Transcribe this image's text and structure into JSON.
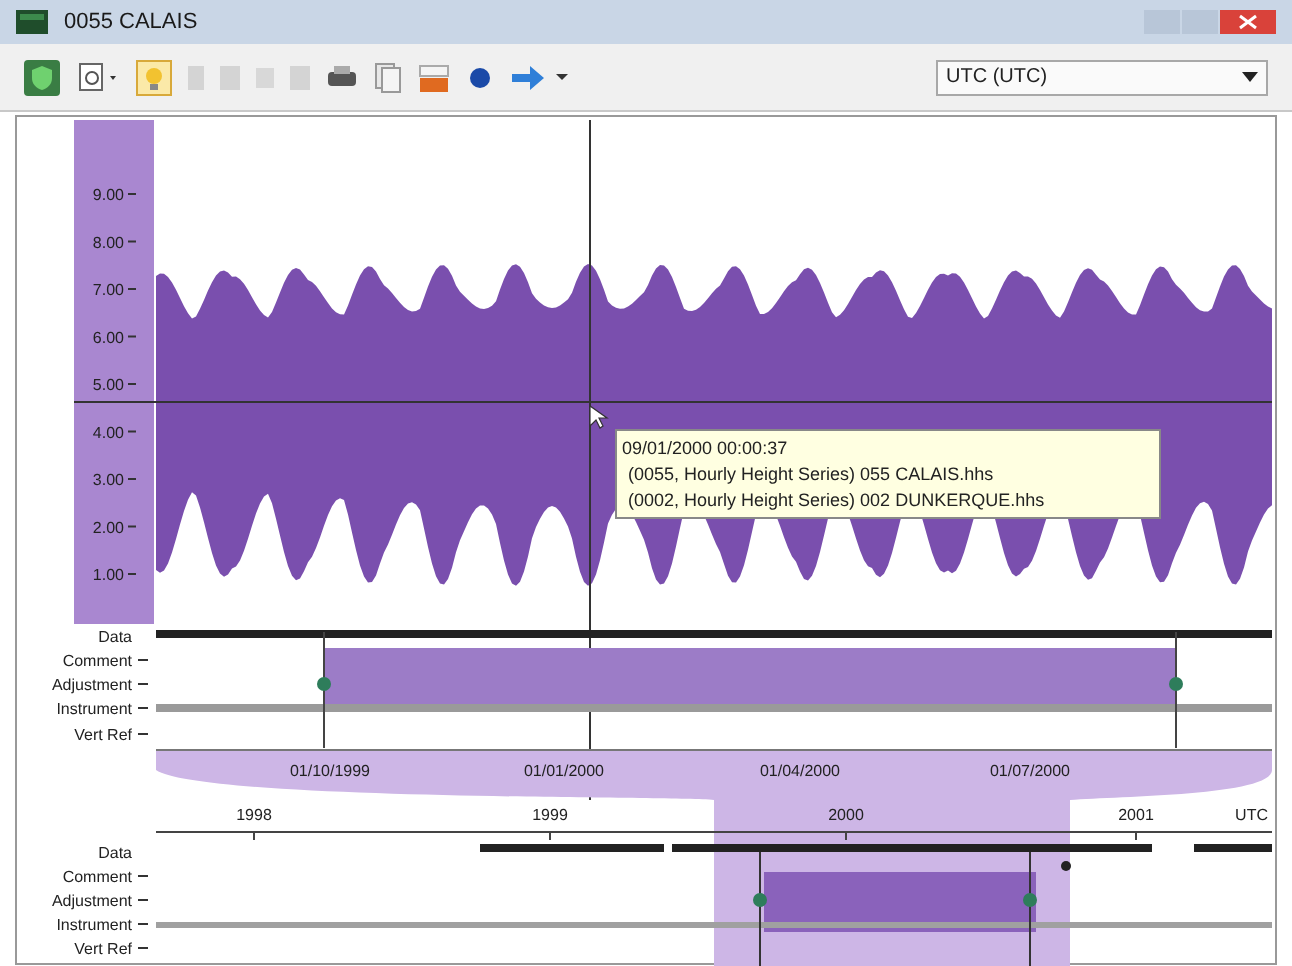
{
  "window": {
    "title": "0055 CALAIS"
  },
  "toolbar": {
    "timezone": "UTC (UTC)"
  },
  "main_chart": {
    "y_ticks": [
      "9.00",
      "8.00",
      "7.00",
      "6.00",
      "5.00",
      "4.00",
      "3.00",
      "2.00",
      "1.00"
    ]
  },
  "tooltip": {
    "lines": [
      "09/01/2000 00:00:37",
      "(0055, Hourly Height Series) 055 CALAIS.hhs",
      "(0002, Hourly Height Series) 002 DUNKERQUE.hhs"
    ]
  },
  "detail_tracks": [
    "Data",
    "Comment",
    "Adjustment",
    "Instrument",
    "Vert Ref"
  ],
  "detail_axis": {
    "dates": [
      "01/10/1999",
      "01/01/2000",
      "01/04/2000",
      "01/07/2000"
    ]
  },
  "overview": {
    "years": [
      "1998",
      "1999",
      "2000",
      "2001"
    ],
    "timezone_label": "UTC"
  },
  "overview_tracks": [
    "Data",
    "Comment",
    "Adjustment",
    "Instrument",
    "Vert Ref"
  ]
}
